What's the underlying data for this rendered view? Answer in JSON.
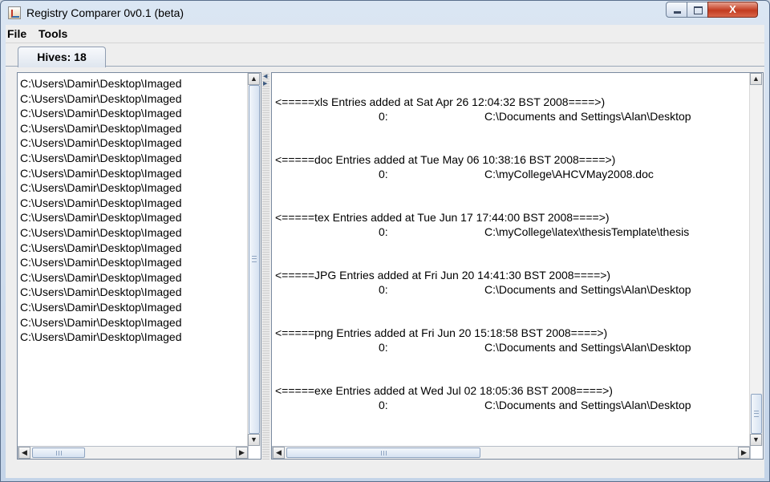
{
  "window": {
    "title": "Registry Comparer 0v0.1 (beta)",
    "icon": "java-app-icon",
    "controls": {
      "minimize": "minimize-icon",
      "maximize": "maximize-icon",
      "close": "X"
    }
  },
  "menu": {
    "items": [
      "File",
      "Tools"
    ]
  },
  "tab": {
    "label": "Hives: 18"
  },
  "hives": {
    "items": [
      "C:\\Users\\Damir\\Desktop\\Imaged",
      "C:\\Users\\Damir\\Desktop\\Imaged",
      "C:\\Users\\Damir\\Desktop\\Imaged",
      "C:\\Users\\Damir\\Desktop\\Imaged",
      "C:\\Users\\Damir\\Desktop\\Imaged",
      "C:\\Users\\Damir\\Desktop\\Imaged",
      "C:\\Users\\Damir\\Desktop\\Imaged",
      "C:\\Users\\Damir\\Desktop\\Imaged",
      "C:\\Users\\Damir\\Desktop\\Imaged",
      "C:\\Users\\Damir\\Desktop\\Imaged",
      "C:\\Users\\Damir\\Desktop\\Imaged",
      "C:\\Users\\Damir\\Desktop\\Imaged",
      "C:\\Users\\Damir\\Desktop\\Imaged",
      "C:\\Users\\Damir\\Desktop\\Imaged",
      "C:\\Users\\Damir\\Desktop\\Imaged",
      "C:\\Users\\Damir\\Desktop\\Imaged",
      "C:\\Users\\Damir\\Desktop\\Imaged",
      "C:\\Users\\Damir\\Desktop\\Imaged"
    ]
  },
  "entries": [
    {
      "header": "<=====xls Entries added at Sat Apr 26 12:04:32 BST 2008====>)",
      "index": "0:",
      "path": "C:\\Documents and Settings\\Alan\\Desktop"
    },
    {
      "header": "<=====doc Entries added at Tue May 06 10:38:16 BST 2008====>)",
      "index": "0:",
      "path": "C:\\myCollege\\AHCVMay2008.doc"
    },
    {
      "header": "<=====tex Entries added at Tue Jun 17 17:44:00 BST 2008====>)",
      "index": "0:",
      "path": "C:\\myCollege\\latex\\thesisTemplate\\thesis"
    },
    {
      "header": "<=====JPG Entries added at Fri Jun 20 14:41:30 BST 2008====>)",
      "index": "0:",
      "path": "C:\\Documents and Settings\\Alan\\Desktop"
    },
    {
      "header": "<=====png Entries added at Fri Jun 20 15:18:58 BST 2008====>)",
      "index": "0:",
      "path": "C:\\Documents and Settings\\Alan\\Desktop"
    },
    {
      "header": "<=====exe Entries added at Wed Jul 02 18:05:36 BST 2008====>)",
      "index": "0:",
      "path": "C:\\Documents and Settings\\Alan\\Desktop"
    }
  ]
}
